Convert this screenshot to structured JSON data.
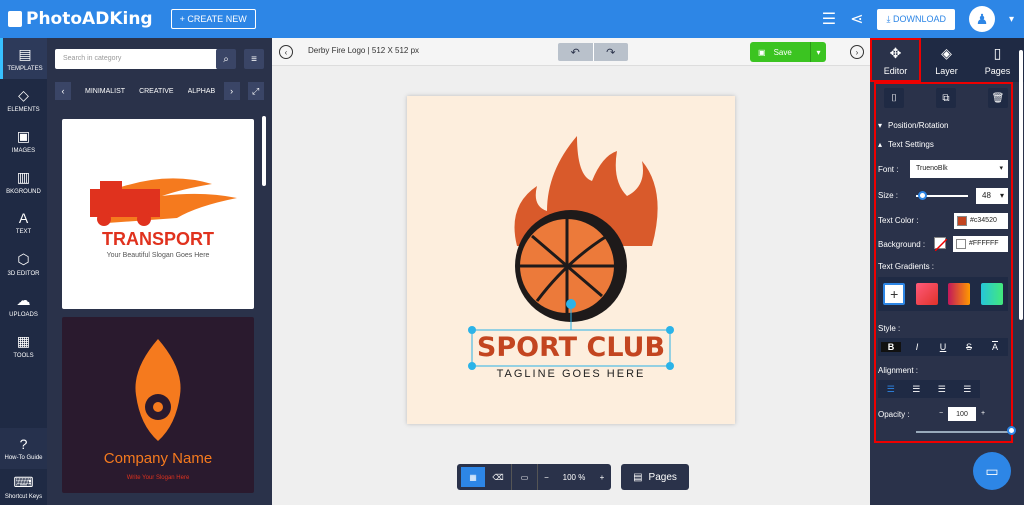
{
  "app": {
    "logo": "PhotoADKing"
  },
  "topbar": {
    "create_label": "+ CREATE NEW",
    "download_label": "DOWNLOAD"
  },
  "leftnav": {
    "items": [
      "TEMPLATES",
      "ELEMENTS",
      "IMAGES",
      "BKGROUND",
      "TEXT",
      "3D EDITOR",
      "UPLOADS",
      "TOOLS"
    ],
    "bottom": [
      "How-To Guide",
      "Shortcut Keys"
    ]
  },
  "panel": {
    "search_placeholder": "Search in category",
    "categories": [
      "MINIMALIST",
      "CREATIVE",
      "ALPHAB"
    ],
    "tile1": {
      "title": "TRANSPORT",
      "slogan": "Your Beautiful Slogan Goes Here"
    },
    "tile2": {
      "title": "Company Name",
      "slogan": "Write Your Slogan Here"
    }
  },
  "canvas": {
    "file_name": "Derby Fire Logo | 512 X 512 px",
    "save_label": "Save",
    "zoom": "100 %",
    "pages_label": "Pages",
    "logo_title": "SPORT CLUB",
    "logo_tagline": "TAGLINE GOES HERE"
  },
  "rpanel": {
    "tabs": [
      "Editor",
      "Layer",
      "Pages"
    ],
    "sections": {
      "position": "Position/Rotation",
      "text": "Text Settings"
    },
    "font_label": "Font :",
    "font_value": "TruenoBlk",
    "size_label": "Size :",
    "size_value": "48",
    "text_color_label": "Text Color :",
    "text_color_value": "#c34520",
    "background_label": "Background :",
    "background_value": "#FFFFFF",
    "gradients_label": "Text Gradients :",
    "style_label": "Style :",
    "style_buttons": [
      "B",
      "I",
      "U",
      "S",
      "A"
    ],
    "alignment_label": "Alignment :",
    "opacity_label": "Opacity :",
    "opacity_value": "100"
  },
  "colors": {
    "accent": "#2d86e6",
    "text_color": "#c34520",
    "save": "#3bc421"
  }
}
